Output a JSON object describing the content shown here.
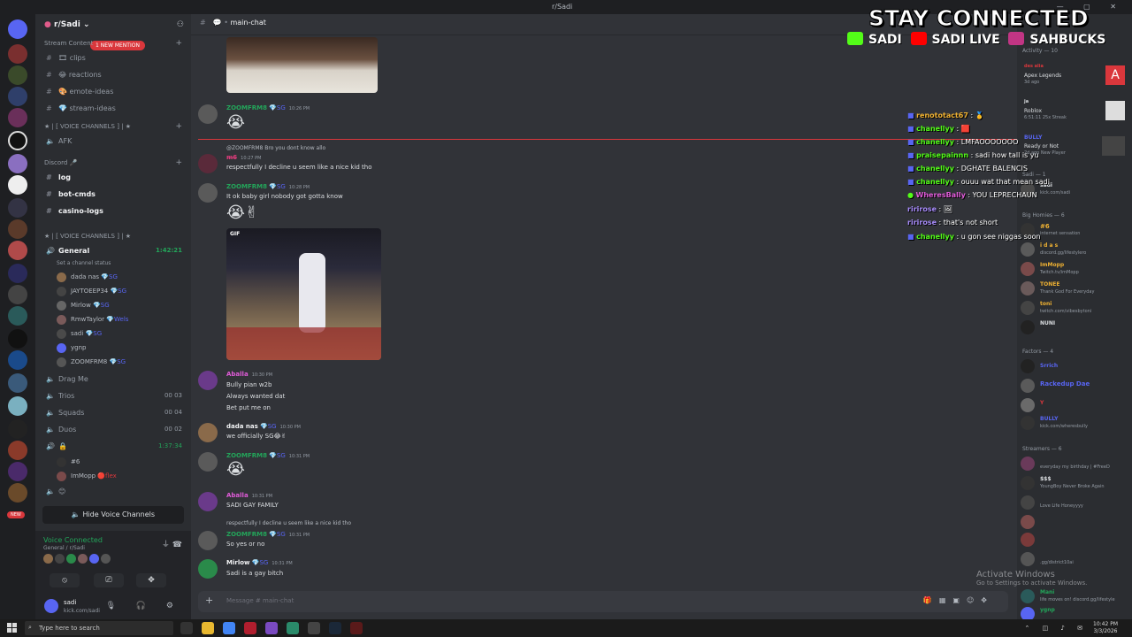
{
  "window": {
    "title": "r/Sadi"
  },
  "server": {
    "name": "r/Sadi",
    "mention_badge": "1 NEW MENTION",
    "sections": {
      "stream_content": "Stream Content",
      "voice_channels_1": "★ | [ VOICE CHANNELS ] | ★",
      "discord": "Discord",
      "voice_channels_2": "★ | [ VOICE CHANNELS ] | ★"
    },
    "channels_top": [
      "clips",
      "reactions",
      "emote-ideas",
      "stream-ideas"
    ],
    "afk": "AFK",
    "discord_channels": [
      "log",
      "bot-cmds",
      "casino-logs"
    ],
    "general": {
      "name": "General",
      "time": "1:42:21",
      "status": "Set a channel status"
    },
    "voice_users": [
      "dada nas",
      "JAYTOEEP34",
      "Mirlow",
      "RmwTaylor",
      "sadi",
      "ygnp",
      "ZOOMFRM8"
    ],
    "drag_me": "Drag Me",
    "rooms": [
      {
        "name": "Trios",
        "count": "00 03"
      },
      {
        "name": "Squads",
        "count": "00 04"
      },
      {
        "name": "Duos",
        "count": "00 02"
      }
    ],
    "locked_time": "1:37:34",
    "locked_users": [
      "#6",
      "ImMopp"
    ],
    "hide_voice": "Hide Voice Channels",
    "new_badge": "NEW"
  },
  "voice_panel": {
    "status": "Voice Connected",
    "channel": "General / r/Sadi"
  },
  "user_panel": {
    "name": "sadi",
    "status": "kick.com/sadi"
  },
  "chat": {
    "channel": "main-chat",
    "messages": [
      {
        "name": "ZOOMFRM8",
        "time": "10:26 PM",
        "text": ""
      },
      {
        "reply": "@ZOOMFRM8  Bro you dont know allo",
        "name": "m̶̶6̶",
        "time": "10:27 PM",
        "text": "respectfully I decline u seem like a nice kid tho"
      },
      {
        "name": "ZOOMFRM8",
        "time": "10:28 PM",
        "text": "It ok baby girl nobody got gotta know"
      },
      {
        "name": "Aballa",
        "time": "10:30 PM",
        "lines": [
          "Bully pian w2b",
          "Always wanted dat",
          "Bet put me on"
        ]
      },
      {
        "name": "dada nas",
        "time": "10:30 PM",
        "text": "we officially SG"
      },
      {
        "name": "ZOOMFRM8",
        "time": "10:31 PM",
        "text": ""
      },
      {
        "name": "Aballa",
        "time": "10:31 PM",
        "text": "SADI GAY FAMILY"
      },
      {
        "reply": "respectfully I decline u seem like a nice kid tho",
        "name": "ZOOMFRM8",
        "time": "10:31 PM",
        "text": "So yes or no"
      },
      {
        "name": "Mirlow",
        "time": "10:31 PM",
        "text": "Sadi is a gay bitch"
      }
    ],
    "gif_label": "GIF",
    "composer_placeholder": "Message #  main-chat"
  },
  "overlay": {
    "title": "STAY CONNECTED",
    "socials": [
      "SADI",
      "SADI LIVE",
      "SAHBUCKS"
    ],
    "chat": [
      {
        "user": "renototact67",
        "msg": ""
      },
      {
        "user": "chanellyy",
        "msg": ""
      },
      {
        "user": "chanellyy",
        "msg": "LMFAOOOOOOO"
      },
      {
        "user": "praisepainnn",
        "msg": "sadi how tall is yu"
      },
      {
        "user": "chanellyy",
        "msg": "DGHATE BALENCIS"
      },
      {
        "user": "chanellyy",
        "msg": "ouuu wat that mean sadi"
      },
      {
        "user": "WheresBally",
        "msg": "YOU LEPRECHAUN"
      },
      {
        "user": "ririrose",
        "msg": ""
      },
      {
        "user": "ririrose",
        "msg": "that's not short"
      },
      {
        "user": "chanellyy",
        "msg": "u gon see niggas soon"
      }
    ],
    "colors": {
      "twitch": "#ff7f50",
      "kick": "#53fc18",
      "youtube": "#ff0000",
      "instagram": "#c13584"
    }
  },
  "members": {
    "activity_header": "Activity — 10",
    "activities": [
      {
        "name": "des alia",
        "status": "Apex Legends",
        "sub": "3d ago"
      },
      {
        "name": "ja",
        "status": "Roblox",
        "sub": "6:51:11  25x Streak"
      },
      {
        "name": "BULLY",
        "status": "Ready or Not",
        "sub": "2d ago  New Player"
      }
    ],
    "sadi_header": "Sadi — 1",
    "sadi": {
      "name": "sadi",
      "status": "kick.com/sadi"
    },
    "big_homies_header": "Big Homies — 6",
    "big_homies": [
      {
        "name": "#6",
        "status": "internet sensation"
      },
      {
        "name": "i d a s",
        "status": "discord.gg/lifestylero"
      },
      {
        "name": "ImMopp",
        "status": "Twitch.tv/imMopp"
      },
      {
        "name": "TONEE",
        "status": "Thank God For Everyday"
      },
      {
        "name": "toni",
        "status": "twitch.com/vibesbytoni"
      },
      {
        "name": "NUNI"
      }
    ],
    "factors_header": "Factors — 4",
    "factors": [
      {
        "name": "Srrich",
        "status": ""
      },
      {
        "name": "Rackedup Dae",
        "status": ""
      },
      {
        "name": "Y",
        "status": ""
      },
      {
        "name": "BULLY",
        "status": "kick.com/wheresbully"
      }
    ],
    "streamers_header": "Streamers — 6",
    "streamers": [
      {
        "name": "",
        "status": "everyday my birthday | #FreeD"
      },
      {
        "name": "$$$",
        "status": "YoungBoy Never Broke Again"
      },
      {
        "name": "",
        "status": "Love Life Honeyyyy"
      },
      {
        "name": "",
        "status": ""
      },
      {
        "name": "",
        "status": ""
      },
      {
        "name": "",
        "status": ".gg/district10ai"
      }
    ],
    "mani": {
      "name": "Mani",
      "status": "life moves on! discord.gg/lifestyle"
    },
    "ygnp": {
      "name": "ygnp"
    }
  },
  "watermark": {
    "title": "Activate Windows",
    "sub": "Go to Settings to activate Windows."
  },
  "taskbar": {
    "search": "Type here to search",
    "time": "10:42 PM",
    "date": "3/3/2026"
  }
}
